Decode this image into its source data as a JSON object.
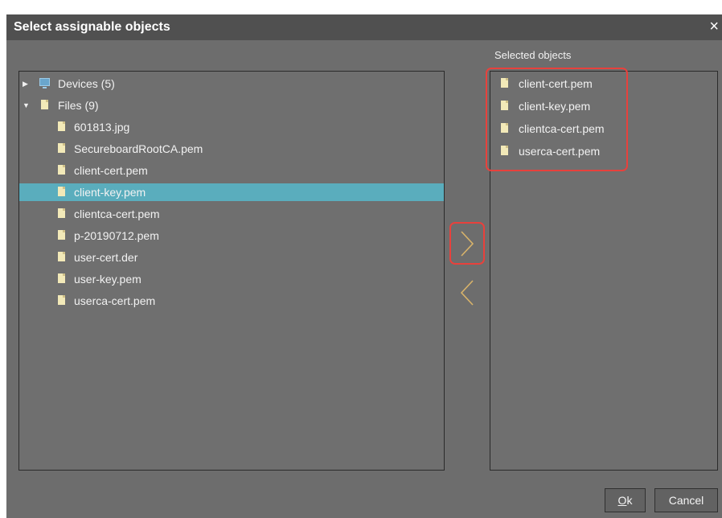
{
  "dialog": {
    "title": "Select assignable objects",
    "close_symbol": "×"
  },
  "available_tree": [
    {
      "label": "Devices (5)",
      "expanded": false,
      "icon": "monitor-icon",
      "children": []
    },
    {
      "label": "Files (9)",
      "expanded": true,
      "icon": "file-icon",
      "children": [
        {
          "label": "601813.jpg"
        },
        {
          "label": "SecureboardRootCA.pem"
        },
        {
          "label": "client-cert.pem"
        },
        {
          "label": "client-key.pem",
          "selected": true
        },
        {
          "label": "clientca-cert.pem"
        },
        {
          "label": "p-20190712.pem"
        },
        {
          "label": "user-cert.der"
        },
        {
          "label": "user-key.pem"
        },
        {
          "label": "userca-cert.pem"
        }
      ]
    }
  ],
  "selected_panel": {
    "heading": "Selected objects",
    "items": [
      "client-cert.pem",
      "client-key.pem",
      "clientca-cert.pem",
      "userca-cert.pem"
    ]
  },
  "buttons": {
    "ok_mnemonic": "O",
    "ok_rest": "k",
    "cancel": "Cancel"
  },
  "colors": {
    "dialog_bg": "#6d6d6d",
    "titlebar_bg": "#505050",
    "selection": "#5aadbd",
    "highlight": "#e8413c",
    "arrow": "#d8b36a"
  }
}
